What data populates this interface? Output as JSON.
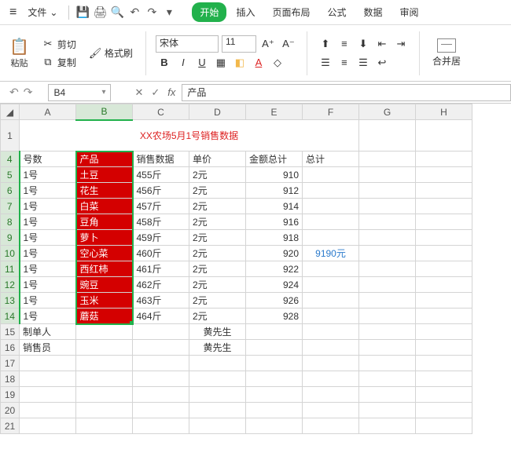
{
  "menubar": {
    "file": "文件",
    "tabs": [
      "开始",
      "插入",
      "页面布局",
      "公式",
      "数据",
      "审阅"
    ]
  },
  "ribbon": {
    "paste": "粘贴",
    "cut": "剪切",
    "copy": "复制",
    "format_painter": "格式刷",
    "font_name": "宋体",
    "font_size": "11",
    "merge": "合并居"
  },
  "namebox": "B4",
  "formula": "产品",
  "chart_data": {
    "type": "table",
    "title": "XX农场5月1号销售数据",
    "columns": [
      "号数",
      "产品",
      "销售数据",
      "单价",
      "金额总计",
      "总计"
    ],
    "rows": [
      {
        "号数": "1号",
        "产品": "土豆",
        "销售数据": "455斤",
        "单价": "2元",
        "金额总计": 910
      },
      {
        "号数": "1号",
        "产品": "花生",
        "销售数据": "456斤",
        "单价": "2元",
        "金额总计": 912
      },
      {
        "号数": "1号",
        "产品": "白菜",
        "销售数据": "457斤",
        "单价": "2元",
        "金额总计": 914
      },
      {
        "号数": "1号",
        "产品": "豆角",
        "销售数据": "458斤",
        "单价": "2元",
        "金额总计": 916
      },
      {
        "号数": "1号",
        "产品": "萝卜",
        "销售数据": "459斤",
        "单价": "2元",
        "金额总计": 918
      },
      {
        "号数": "1号",
        "产品": "空心菜",
        "销售数据": "460斤",
        "单价": "2元",
        "金额总计": 920
      },
      {
        "号数": "1号",
        "产品": "西红柿",
        "销售数据": "461斤",
        "单价": "2元",
        "金额总计": 922
      },
      {
        "号数": "1号",
        "产品": "豌豆",
        "销售数据": "462斤",
        "单价": "2元",
        "金额总计": 924
      },
      {
        "号数": "1号",
        "产品": "玉米",
        "销售数据": "463斤",
        "单价": "2元",
        "金额总计": 926
      },
      {
        "号数": "1号",
        "产品": "蘑菇",
        "销售数据": "464斤",
        "单价": "2元",
        "金额总计": 928
      }
    ],
    "total": "9190元",
    "footer": [
      {
        "label": "制单人",
        "value": "黄先生"
      },
      {
        "label": "销售员",
        "value": "黄先生"
      }
    ]
  },
  "cols": [
    "A",
    "B",
    "C",
    "D",
    "E",
    "F",
    "G",
    "H"
  ]
}
